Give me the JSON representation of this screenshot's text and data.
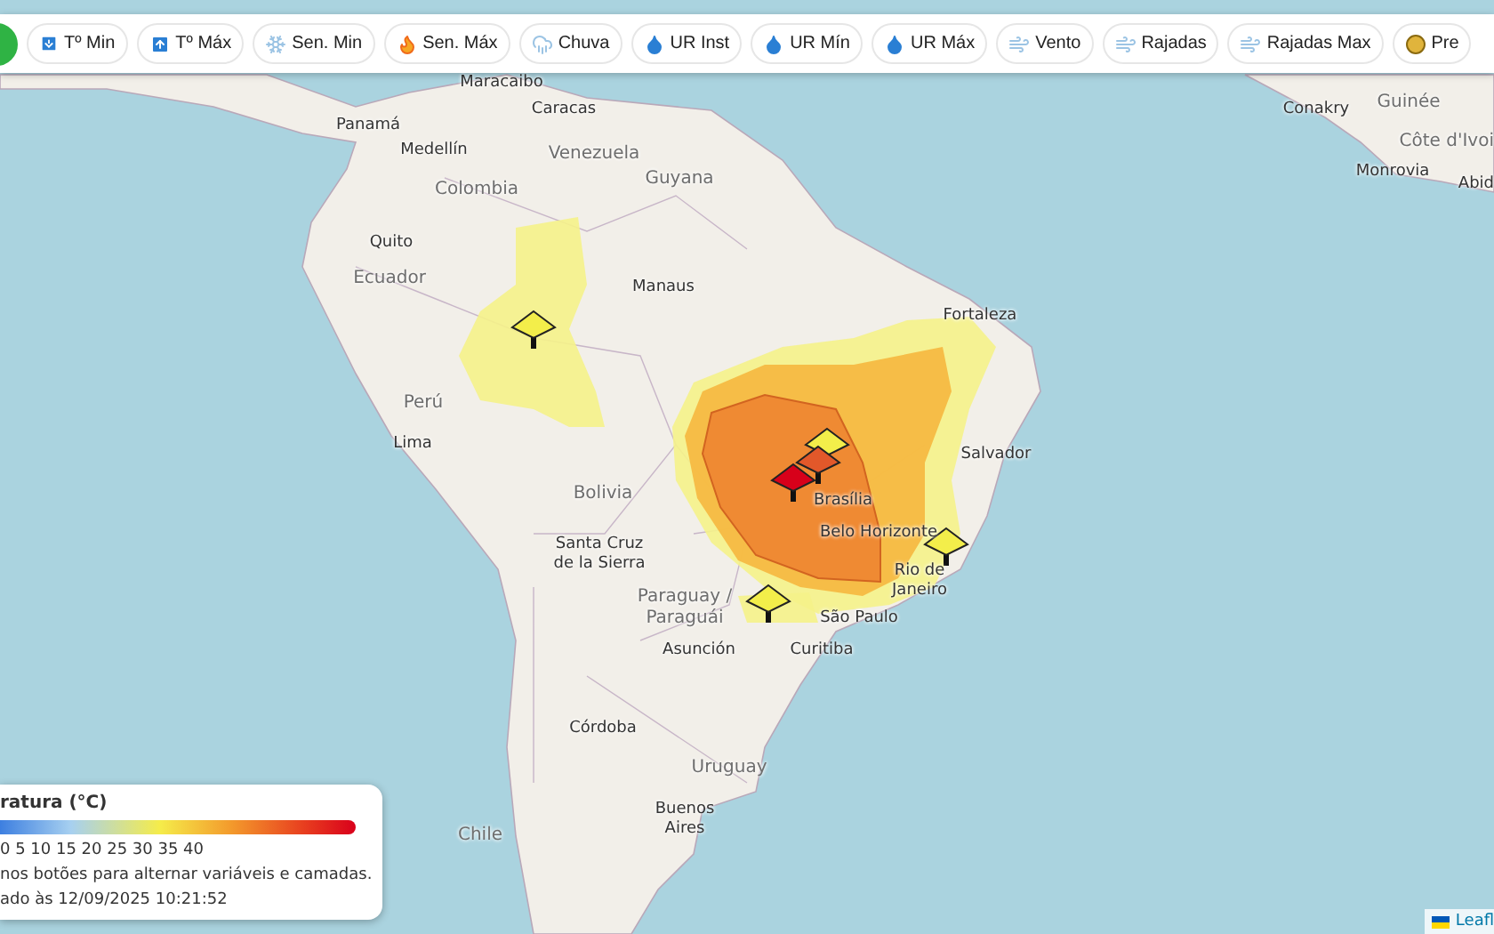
{
  "toolbar": {
    "buttons": [
      {
        "label": "Tº Min"
      },
      {
        "label": "Tº Máx"
      },
      {
        "label": "Sen. Min"
      },
      {
        "label": "Sen. Máx"
      },
      {
        "label": "Chuva"
      },
      {
        "label": "UR Inst"
      },
      {
        "label": "UR Mín"
      },
      {
        "label": "UR Máx"
      },
      {
        "label": "Vento"
      },
      {
        "label": "Rajadas"
      },
      {
        "label": "Rajadas Max"
      },
      {
        "label": "Pre"
      }
    ]
  },
  "map": {
    "labels": [
      {
        "text": "Maracaibo",
        "kind": "city"
      },
      {
        "text": "Caracas",
        "kind": "city"
      },
      {
        "text": "Panamá",
        "kind": "city"
      },
      {
        "text": "Medellín",
        "kind": "city"
      },
      {
        "text": "Venezuela",
        "kind": "country"
      },
      {
        "text": "Guyana",
        "kind": "country"
      },
      {
        "text": "Colombia",
        "kind": "country"
      },
      {
        "text": "Quito",
        "kind": "city"
      },
      {
        "text": "Ecuador",
        "kind": "country"
      },
      {
        "text": "Manaus",
        "kind": "city"
      },
      {
        "text": "Fortaleza",
        "kind": "city"
      },
      {
        "text": "Perú",
        "kind": "country"
      },
      {
        "text": "Lima",
        "kind": "city"
      },
      {
        "text": "Bolivia",
        "kind": "country"
      },
      {
        "text": "Brasília",
        "kind": "city"
      },
      {
        "text": "Salvador",
        "kind": "city"
      },
      {
        "text": "Santa Cruz de la Sierra",
        "kind": "city"
      },
      {
        "text": "Belo Horizonte",
        "kind": "city"
      },
      {
        "text": "Rio de Janeiro",
        "kind": "city"
      },
      {
        "text": "Paraguay / Paraguái",
        "kind": "country"
      },
      {
        "text": "São Paulo",
        "kind": "city"
      },
      {
        "text": "Asunción",
        "kind": "city"
      },
      {
        "text": "Curitiba",
        "kind": "city"
      },
      {
        "text": "Córdoba",
        "kind": "city"
      },
      {
        "text": "Uruguay",
        "kind": "country"
      },
      {
        "text": "Buenos Aires",
        "kind": "city"
      },
      {
        "text": "Chile",
        "kind": "country"
      },
      {
        "text": "Conakry",
        "kind": "city"
      },
      {
        "text": "Guinée",
        "kind": "country"
      },
      {
        "text": "Côte d'Ivoi",
        "kind": "country"
      },
      {
        "text": "Monrovia",
        "kind": "city"
      },
      {
        "text": "Abid",
        "kind": "city"
      }
    ]
  },
  "legend": {
    "title": "ratura (°C)",
    "scale": "0 5 10 15 20 25 30 35 40",
    "hint": "nos botões para alternar variáveis e camadas.",
    "updated": "ado às 12/09/2025 10:21:52"
  },
  "attribution": "Leafl"
}
